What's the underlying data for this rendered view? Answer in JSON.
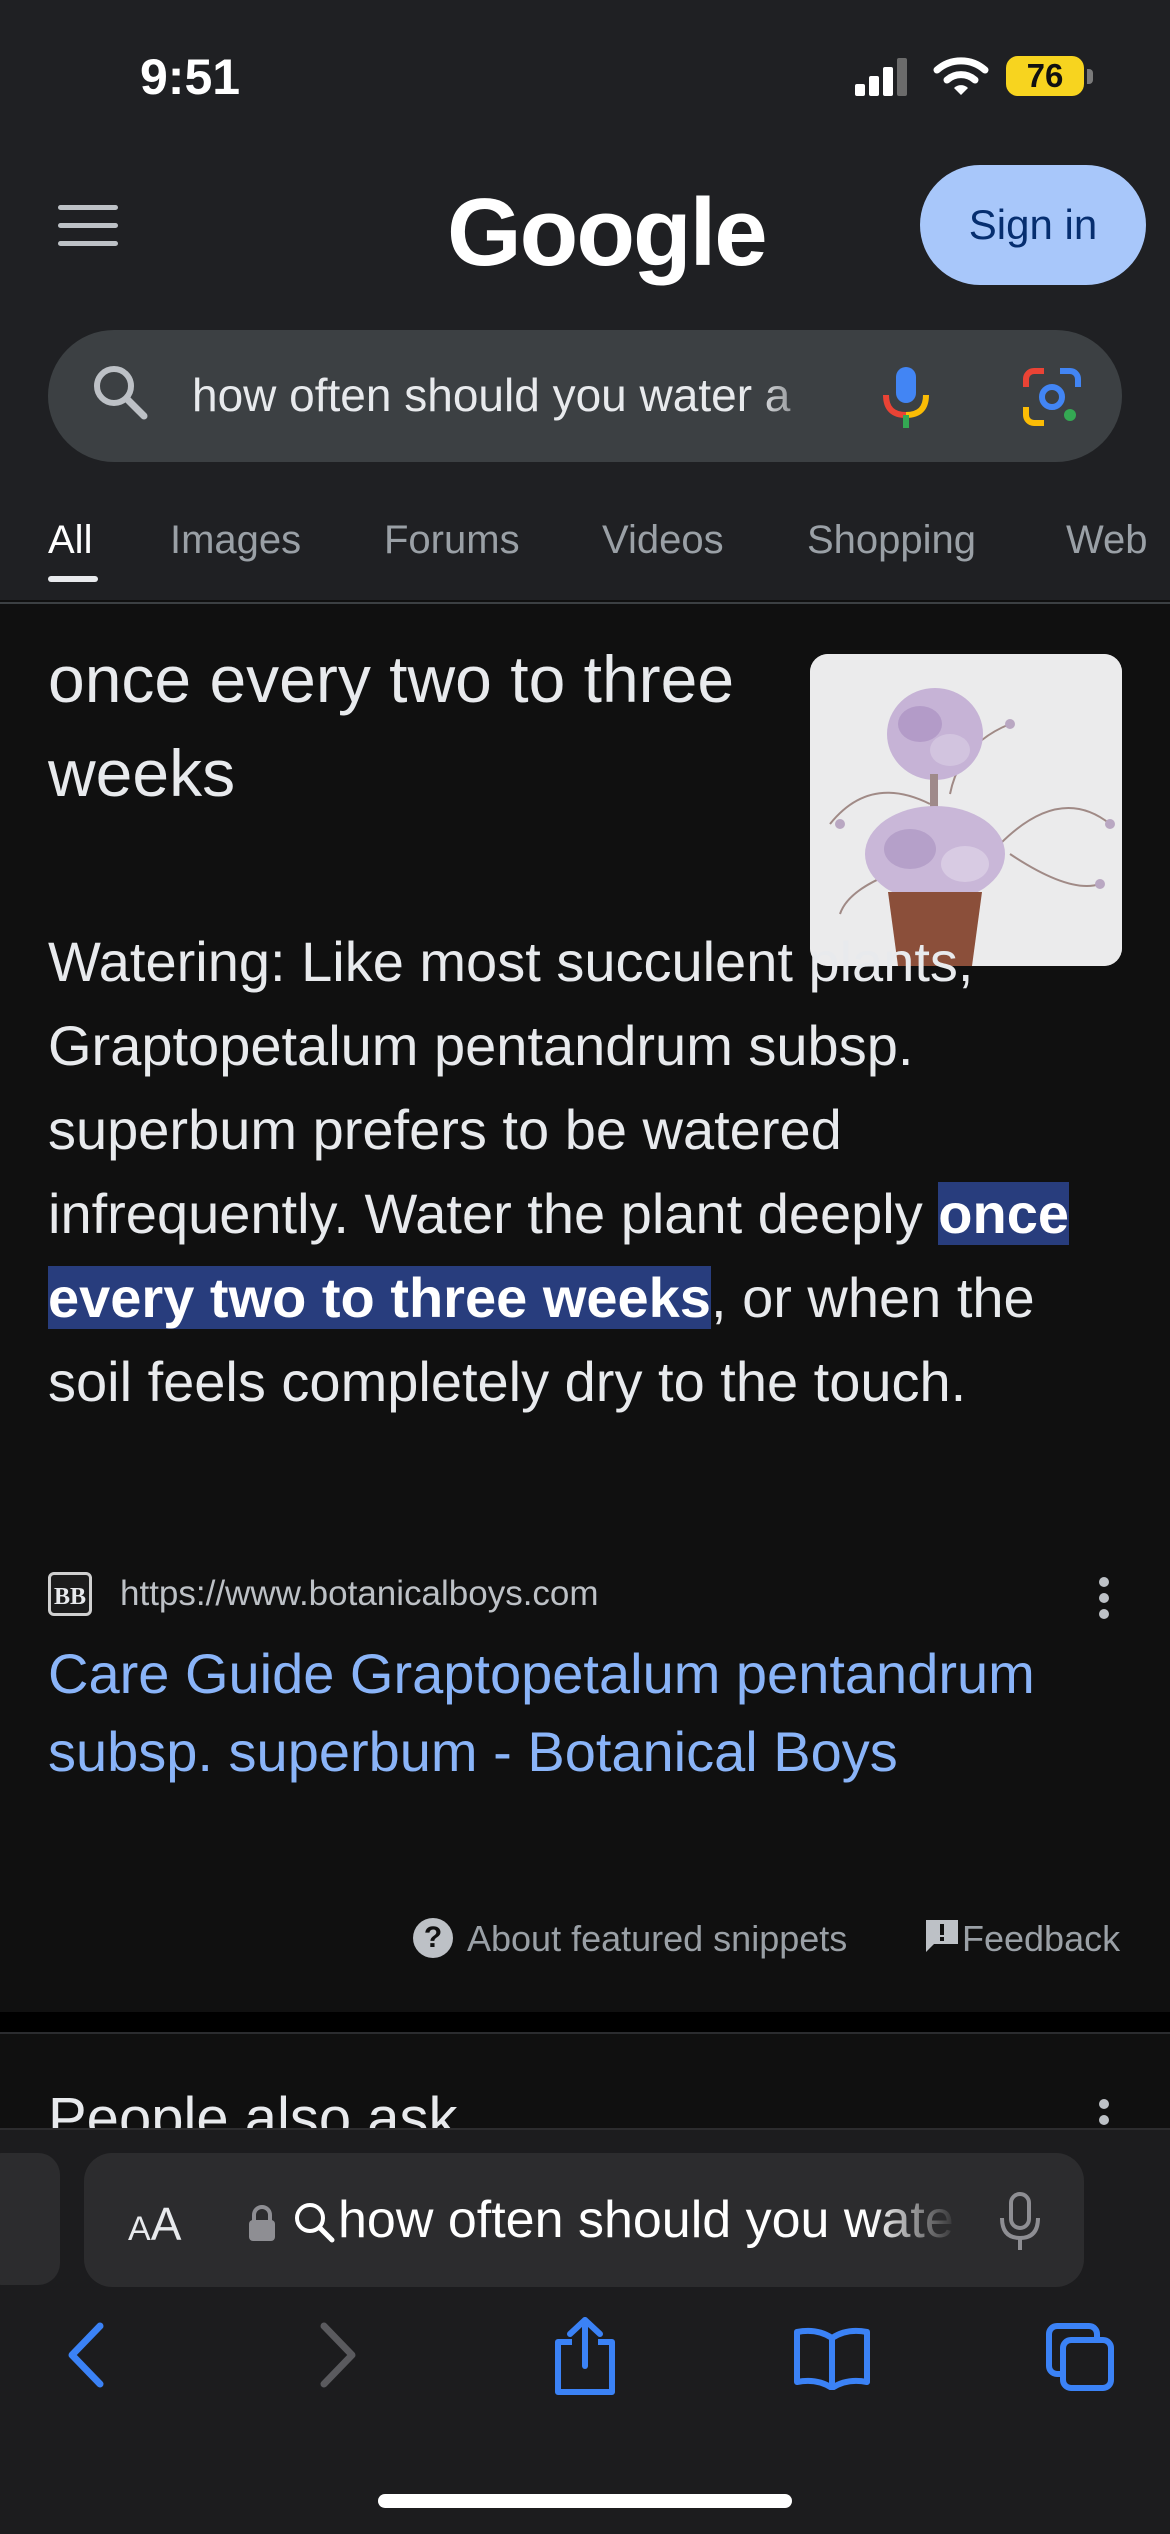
{
  "status_bar": {
    "time": "9:51",
    "battery": "76"
  },
  "header": {
    "logo": "Google",
    "sign_in_label": "Sign in"
  },
  "search": {
    "query": "how often should you water a"
  },
  "tabs": [
    {
      "label": "All",
      "active": true
    },
    {
      "label": "Images"
    },
    {
      "label": "Forums"
    },
    {
      "label": "Videos"
    },
    {
      "label": "Shopping"
    },
    {
      "label": "Web"
    }
  ],
  "featured_snippet": {
    "answer_title": "once every two to three weeks",
    "text_before": "Watering: Like most succulent plants, Graptopetalum pentandrum subsp. superbum prefers to be watered infrequently. Water the plant deeply ",
    "highlight": "once every two to three weeks",
    "text_after": ", or when the soil feels completely dry to the touch.",
    "source_favicon": "BB",
    "source_url": "https://www.botanicalboys.com",
    "link_title": "Care Guide Graptopetalum pentandrum subsp. superbum - Botanical Boys",
    "about_label": "About featured snippets",
    "feedback_label": "Feedback"
  },
  "people_also_ask": {
    "title": "People also ask"
  },
  "browser": {
    "aa_small": "A",
    "aa_large": "A",
    "url_text": "how often should you water a"
  },
  "colors": {
    "link": "#8ab4f8",
    "highlight_bg": "#283d7d",
    "sign_in_bg": "#a8c7fa",
    "battery": "#f7d41f",
    "safari_accent": "#3b82f6"
  }
}
